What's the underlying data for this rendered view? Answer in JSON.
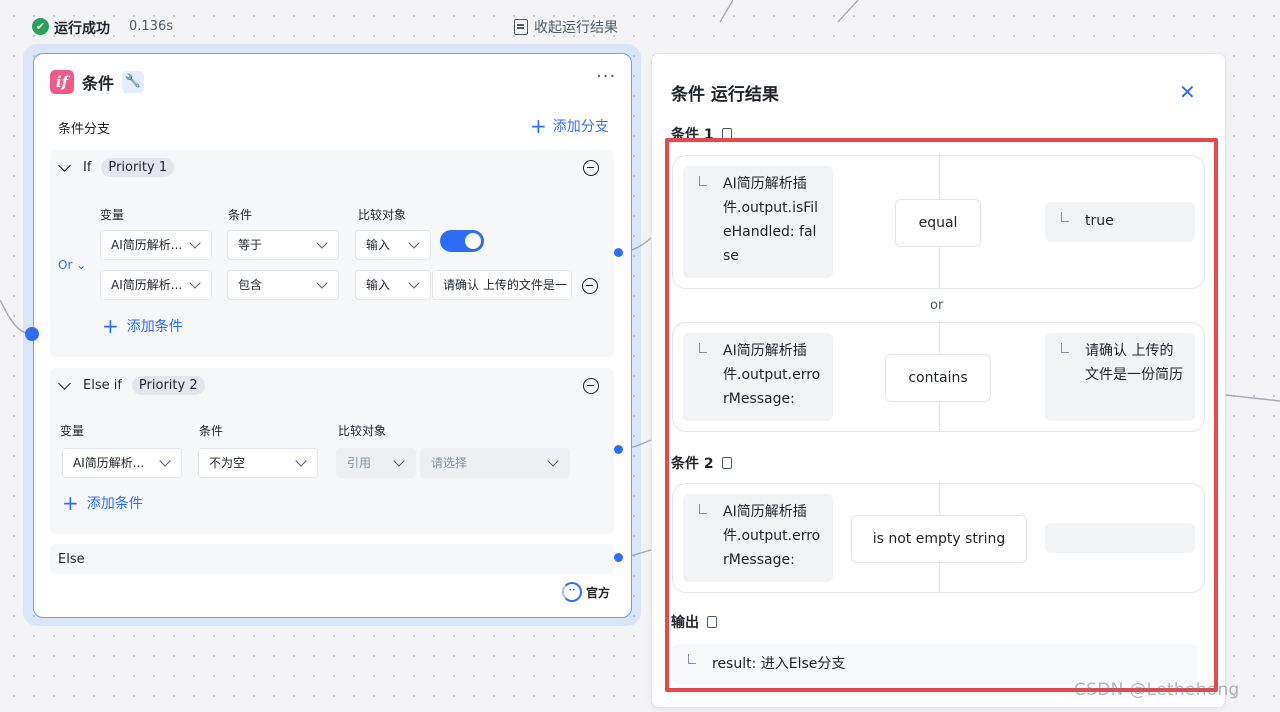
{
  "run_status": {
    "label": "运行成功",
    "time": "0.136s",
    "collapse_label": "收起运行结果"
  },
  "node": {
    "icon_text": "if",
    "title": "条件",
    "more_label": "···",
    "section_label": "条件分支",
    "add_branch_label": "添加分支",
    "branches": [
      {
        "kind": "If",
        "priority": "Priority 1",
        "column_labels": [
          "变量",
          "条件",
          "比较对象"
        ],
        "logic": "Or",
        "conditions": [
          {
            "variable": "AI简历解析...",
            "operator": "等于",
            "ref_type": "输入",
            "value": "toggle-on"
          },
          {
            "variable": "AI简历解析...",
            "operator": "包含",
            "ref_type": "输入",
            "value": "请确认 上传的文件是一"
          }
        ],
        "add_condition_label": "添加条件"
      },
      {
        "kind": "Else if",
        "priority": "Priority 2",
        "column_labels": [
          "变量",
          "条件",
          "比较对象"
        ],
        "conditions": [
          {
            "variable": "AI简历解析...",
            "operator": "不为空",
            "ref_type": "引用",
            "placeholder": "请选择"
          }
        ],
        "add_condition_label": "添加条件"
      },
      {
        "kind": "Else"
      }
    ],
    "badge": "官方",
    "accent_color": "#2e6ef5",
    "icon_color": "#ef5b86"
  },
  "result_panel": {
    "title": "条件 运行结果",
    "close_icon": "close-icon",
    "condition1": {
      "label": "条件 1",
      "rows": [
        {
          "left": "AI简历解析插件.output.isFileHandled: false",
          "op": "equal",
          "right": "true"
        },
        {
          "left": "AI简历解析插件.output.errorMessage:",
          "op": "contains",
          "right": "请确认 上传的文件是一份简历"
        }
      ],
      "joiner": "or"
    },
    "condition2": {
      "label": "条件 2",
      "rows": [
        {
          "left": "AI简历解析插件.output.errorMessage:",
          "op": "is not empty string",
          "right": ""
        }
      ]
    },
    "output": {
      "label": "输出",
      "value": "result: 进入Else分支"
    },
    "highlight_color": "#e8484a"
  },
  "watermark": "CSDN @Lethehong"
}
